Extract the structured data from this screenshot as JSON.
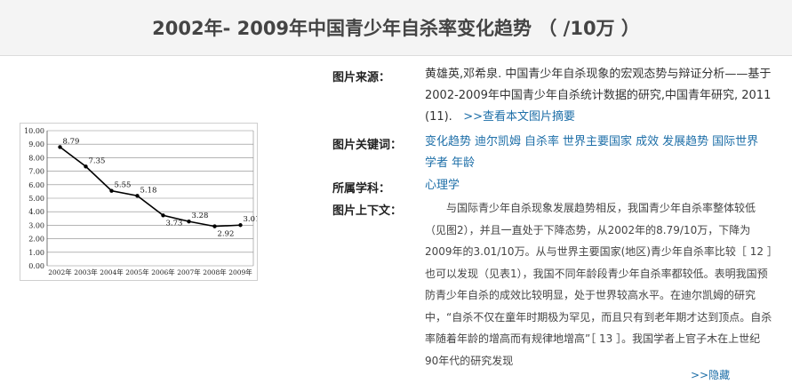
{
  "header": {
    "title": "2002年- 2009年中国青少年自杀率变化趋势 （ /10万 ）"
  },
  "meta": {
    "source_label": "图片来源：",
    "source_authors": "黄雄英,邓希泉.",
    "source_text": "中国青少年自杀现象的宏观态势与辩证分析——基于2002-2009年中国青少年自杀统计数据的研究",
    "source_journal": ",中国青年研究,",
    "source_year": " 2011 (11).",
    "source_link": ">>查看本文图片摘要",
    "keywords_label": "图片关键词：",
    "keywords": [
      "变化趋势",
      "迪尔凯姆",
      "自杀率",
      "世界主要国家",
      "成效",
      "发展趋势",
      "国际世界",
      "学者",
      "年龄"
    ],
    "subject_label": "所属学科：",
    "subject": "心理学",
    "context_label": "图片上下文：",
    "context": "与国际青少年自杀现象发展趋势相反，我国青少年自杀率整体较低（见图2），并且一直处于下降态势，从2002年的8.79/10万，下降为2009年的3.01/10万。从与世界主要国家(地区)青少年自杀率比较［ 12 ］也可以发现（见表1），我国不同年龄段青少年自杀率都较低。表明我国预防青少年自杀的成效比较明显，处于世界较高水平。在迪尔凯姆的研究中，“自杀不仅在童年时期极为罕见，而且只有到老年期才达到顶点。自杀率随着年龄的增高而有规律地增高”［ 13 ］。我国学者上官子木在上世纪90年代的研究发现",
    "hide_link": ">>隐藏"
  },
  "chart_data": {
    "type": "line",
    "categories": [
      "2002年",
      "2003年",
      "2004年",
      "2005年",
      "2006年",
      "2007年",
      "2008年",
      "2009年"
    ],
    "values": [
      8.79,
      7.35,
      5.55,
      5.18,
      3.73,
      3.28,
      2.92,
      3.01
    ],
    "data_labels": [
      "8.79",
      "7.35",
      "5.55",
      "5.18",
      "3.73",
      "3.28",
      "2.92",
      "3.01"
    ],
    "yticks": [
      "0.00",
      "1.00",
      "2.00",
      "3.00",
      "4.00",
      "5.00",
      "6.00",
      "7.00",
      "8.00",
      "9.00",
      "10.00"
    ],
    "ylim": [
      0,
      10
    ],
    "grid": true,
    "line_color": "#000000"
  }
}
